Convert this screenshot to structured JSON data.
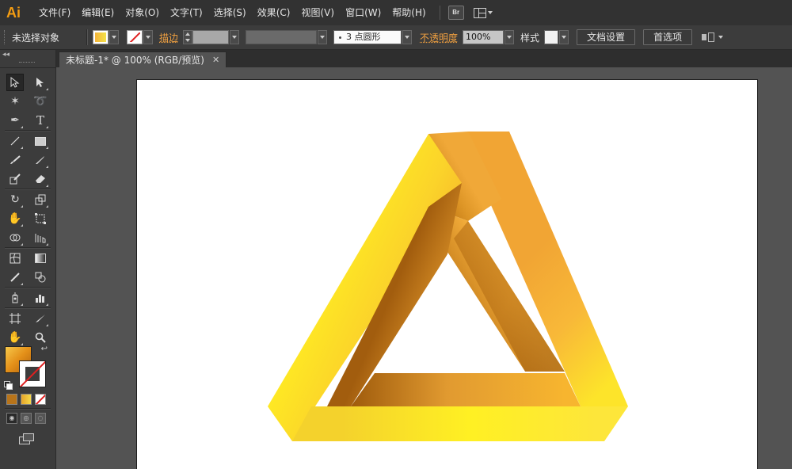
{
  "app": {
    "logo_text": "Ai"
  },
  "menu": {
    "items": [
      "文件(F)",
      "编辑(E)",
      "对象(O)",
      "文字(T)",
      "选择(S)",
      "效果(C)",
      "视图(V)",
      "窗口(W)",
      "帮助(H)"
    ],
    "bridge_label": "Br"
  },
  "control_bar": {
    "selection_status": "未选择对象",
    "stroke_label": "描边",
    "brush_value": "3 点圆形",
    "opacity_label": "不透明度",
    "opacity_value": "100%",
    "style_label": "样式",
    "doc_setup_button": "文档设置",
    "preferences_button": "首选项"
  },
  "document": {
    "tab_title": "未标题-1* @ 100% (RGB/预览)",
    "close_glyph": "✕"
  },
  "tools": {
    "collapse_glyph": "◂◂",
    "rows": [
      {
        "left": "selection-tool",
        "right": "direct-selection-tool"
      },
      {
        "left": "magic-wand-tool",
        "right": "lasso-tool"
      },
      {
        "left": "pen-tool",
        "right": "type-tool",
        "right_glyph": "T"
      },
      {
        "left": "line-segment-tool",
        "right": "rectangle-tool"
      },
      {
        "left": "paintbrush-tool",
        "right": "pencil-tool"
      },
      {
        "left": "blob-brush-tool",
        "right": "eraser-tool"
      },
      {
        "left": "rotate-tool",
        "right": "scale-tool"
      },
      {
        "left": "warp-tool",
        "right": "free-transform-tool"
      },
      {
        "left": "shape-builder-tool",
        "right": "perspective-grid-tool"
      },
      {
        "left": "mesh-tool",
        "right": "gradient-tool"
      },
      {
        "left": "eyedropper-tool",
        "right": "blend-tool"
      },
      {
        "left": "symbol-sprayer-tool",
        "right": "column-graph-tool"
      },
      {
        "left": "artboard-tool",
        "right": "slice-tool"
      },
      {
        "left": "hand-tool",
        "right": "zoom-tool"
      }
    ]
  },
  "colors": {
    "fill_gradient": [
      "#f7c84a",
      "#e38f18"
    ],
    "triangle_light": "#ffee22",
    "triangle_orange": "#f8b034",
    "triangle_brown": "#a6600e",
    "stroke_none": "#e02020"
  }
}
